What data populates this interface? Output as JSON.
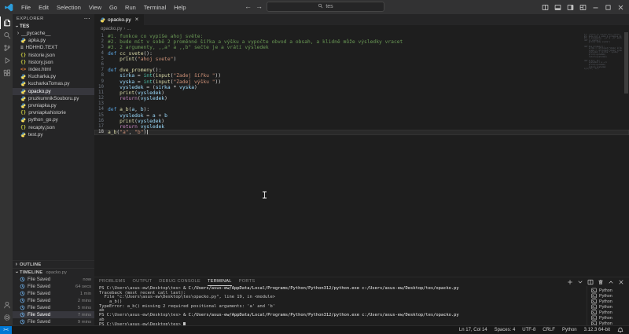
{
  "titlebar": {
    "menu": [
      "File",
      "Edit",
      "Selection",
      "View",
      "Go",
      "Run",
      "Terminal",
      "Help"
    ],
    "search_value": "tes",
    "window_icons": [
      "split-editor",
      "toggle-panel",
      "toggle-secondary-sidebar",
      "customize-layout",
      "minimize",
      "maximize",
      "close"
    ]
  },
  "activity_bar": {
    "top": [
      {
        "id": "explorer",
        "label": "Explorer",
        "active": true
      },
      {
        "id": "search",
        "label": "Search"
      },
      {
        "id": "source-control",
        "label": "Source Control"
      },
      {
        "id": "run-debug",
        "label": "Run and Debug"
      },
      {
        "id": "extensions",
        "label": "Extensions"
      }
    ],
    "bottom": [
      {
        "id": "accounts",
        "label": "Accounts"
      },
      {
        "id": "settings",
        "label": "Settings"
      }
    ]
  },
  "sidebar": {
    "explorer_title": "EXPLORER",
    "root": "TES",
    "files": [
      {
        "name": "__pycache__",
        "type": "folder"
      },
      {
        "name": "apka.py",
        "type": "python"
      },
      {
        "name": "HDHHD.TEXT",
        "type": "text"
      },
      {
        "name": "historie.json",
        "type": "json"
      },
      {
        "name": "history.json",
        "type": "json"
      },
      {
        "name": "index.html",
        "type": "html"
      },
      {
        "name": "Kucharka.py",
        "type": "python"
      },
      {
        "name": "kucharkaTomas.py",
        "type": "python"
      },
      {
        "name": "opacko.py",
        "type": "python",
        "selected": true
      },
      {
        "name": "pruzkumnikSouboru.py",
        "type": "python"
      },
      {
        "name": "prvniapka.py",
        "type": "python"
      },
      {
        "name": "prvniapkahistorie",
        "type": "json"
      },
      {
        "name": "python_go.py",
        "type": "python"
      },
      {
        "name": "recapty.json",
        "type": "json"
      },
      {
        "name": "test.py",
        "type": "python"
      }
    ],
    "outline_title": "OUTLINE",
    "timeline": {
      "title": "TIMELINE",
      "context": "opacko.py",
      "items": [
        {
          "label": "File Saved",
          "time": "now"
        },
        {
          "label": "File Saved",
          "time": "64 secs"
        },
        {
          "label": "File Saved",
          "time": "1 min"
        },
        {
          "label": "File Saved",
          "time": "2 mins"
        },
        {
          "label": "File Saved",
          "time": "5 mins"
        },
        {
          "label": "File Saved",
          "time": "7 mins",
          "selected": true
        },
        {
          "label": "File Saved",
          "time": "9 mins"
        }
      ]
    }
  },
  "editor": {
    "tab": {
      "name": "opacko.py"
    },
    "breadcrumb": [
      "opacko.py",
      "..."
    ],
    "cursor": {
      "line": 17,
      "col": 14
    },
    "lines": [
      {
        "segments": [
          {
            "t": "#1. funkce co vypíše ahoj světe:",
            "c": "cm"
          }
        ]
      },
      {
        "segments": [
          {
            "t": "#2. bude mít v sobě 2 proměnné šířka a výšku a vypočte obvod a obsah, a klidně může výsledky vracet",
            "c": "cm"
          }
        ]
      },
      {
        "segments": [
          {
            "t": "#3. 2 argumenty, ,,a\" a ,,b\" sečte je a vrátí výsledek",
            "c": "cm"
          }
        ]
      },
      {
        "segments": [
          {
            "t": "def ",
            "c": "kw"
          },
          {
            "t": "cc_svete",
            "c": "fn"
          },
          {
            "t": "():",
            "c": "pl"
          }
        ]
      },
      {
        "segments": [
          {
            "t": "    ",
            "c": "pl"
          },
          {
            "t": "print",
            "c": "fn"
          },
          {
            "t": "(",
            "c": "pl"
          },
          {
            "t": "\"ahoj svete\"",
            "c": "str"
          },
          {
            "t": ")",
            "c": "pl"
          }
        ]
      },
      {
        "segments": []
      },
      {
        "segments": [
          {
            "t": "def ",
            "c": "kw"
          },
          {
            "t": "dve_promeny",
            "c": "fn"
          },
          {
            "t": "():",
            "c": "pl"
          }
        ]
      },
      {
        "segments": [
          {
            "t": "    ",
            "c": "pl"
          },
          {
            "t": "sirka",
            "c": "var"
          },
          {
            "t": " = ",
            "c": "pl"
          },
          {
            "t": "int",
            "c": "bi"
          },
          {
            "t": "(",
            "c": "pl"
          },
          {
            "t": "input",
            "c": "fn"
          },
          {
            "t": "(",
            "c": "pl"
          },
          {
            "t": "\"Zadej šířku \"",
            "c": "str"
          },
          {
            "t": "))",
            "c": "pl"
          }
        ]
      },
      {
        "segments": [
          {
            "t": "    ",
            "c": "pl"
          },
          {
            "t": "vyska",
            "c": "var"
          },
          {
            "t": " = ",
            "c": "pl"
          },
          {
            "t": "int",
            "c": "bi"
          },
          {
            "t": "(",
            "c": "pl"
          },
          {
            "t": "input",
            "c": "fn"
          },
          {
            "t": "(",
            "c": "pl"
          },
          {
            "t": "\"Zadej výšku \"",
            "c": "str"
          },
          {
            "t": "))",
            "c": "pl"
          }
        ]
      },
      {
        "segments": [
          {
            "t": "    ",
            "c": "pl"
          },
          {
            "t": "vysledek",
            "c": "var"
          },
          {
            "t": " = (",
            "c": "pl"
          },
          {
            "t": "sirka",
            "c": "var"
          },
          {
            "t": " * ",
            "c": "pl"
          },
          {
            "t": "vyska",
            "c": "var"
          },
          {
            "t": ")",
            "c": "pl"
          }
        ]
      },
      {
        "segments": [
          {
            "t": "    ",
            "c": "pl"
          },
          {
            "t": "print",
            "c": "fn"
          },
          {
            "t": "(",
            "c": "pl"
          },
          {
            "t": "vysledek",
            "c": "var"
          },
          {
            "t": ")",
            "c": "pl"
          }
        ]
      },
      {
        "segments": [
          {
            "t": "    ",
            "c": "pl"
          },
          {
            "t": "return",
            "c": "ctl"
          },
          {
            "t": "(",
            "c": "pl"
          },
          {
            "t": "vysledek",
            "c": "var"
          },
          {
            "t": ")",
            "c": "pl"
          }
        ]
      },
      {
        "segments": []
      },
      {
        "segments": [
          {
            "t": "def ",
            "c": "kw"
          },
          {
            "t": "a_b",
            "c": "fn"
          },
          {
            "t": "(",
            "c": "pl"
          },
          {
            "t": "a",
            "c": "var"
          },
          {
            "t": ", ",
            "c": "pl"
          },
          {
            "t": "b",
            "c": "var"
          },
          {
            "t": "):",
            "c": "pl"
          }
        ]
      },
      {
        "segments": [
          {
            "t": "    ",
            "c": "pl"
          },
          {
            "t": "vysledok",
            "c": "var"
          },
          {
            "t": " = ",
            "c": "pl"
          },
          {
            "t": "a",
            "c": "var"
          },
          {
            "t": " + ",
            "c": "pl"
          },
          {
            "t": "b",
            "c": "var"
          }
        ]
      },
      {
        "segments": [
          {
            "t": "    ",
            "c": "pl"
          },
          {
            "t": "print",
            "c": "fn"
          },
          {
            "t": "(",
            "c": "pl"
          },
          {
            "t": "vysledek",
            "c": "var"
          },
          {
            "t": ")",
            "c": "pl"
          }
        ]
      },
      {
        "segments": [
          {
            "t": "    ",
            "c": "pl"
          },
          {
            "t": "return ",
            "c": "ctl"
          },
          {
            "t": "vysledek",
            "c": "var"
          }
        ]
      },
      {
        "segments": [
          {
            "t": "a_b",
            "c": "fn"
          },
          {
            "t": "(",
            "c": "pl"
          },
          {
            "t": "\"a\"",
            "c": "str"
          },
          {
            "t": ", ",
            "c": "pl"
          },
          {
            "t": "\"b\"",
            "c": "str"
          },
          {
            "t": ")",
            "c": "pl"
          }
        ],
        "current": true
      }
    ]
  },
  "panel": {
    "tabs": [
      {
        "label": "PROBLEMS"
      },
      {
        "label": "OUTPUT"
      },
      {
        "label": "DEBUG CONSOLE"
      },
      {
        "label": "TERMINAL",
        "active": true
      },
      {
        "label": "PORTS"
      }
    ],
    "actions": [
      "new-terminal",
      "launch-profile",
      "split-terminal",
      "kill-terminal",
      "maximize-panel",
      "close-panel"
    ],
    "terminal": [
      {
        "parts": [
          {
            "t": "PS C:\\Users\\asus-ew\\Desktop\\tes> ",
            "c": "prompt"
          },
          {
            "t": "& C:/Users/asus-ew/AppData/Local/Programs/Python/Python312/python.exe c:/Users/asus-ew/Desktop/tes/opacko.py",
            "c": "cmd"
          }
        ]
      },
      {
        "parts": [
          {
            "t": "Traceback (most recent call last):",
            "c": "out"
          }
        ]
      },
      {
        "parts": [
          {
            "t": "  File \"c:\\Users\\asus-ew\\Desktop\\tes\\opacko.py\", line 19, in <module>",
            "c": "out"
          }
        ]
      },
      {
        "parts": [
          {
            "t": "    a_b()",
            "c": "out"
          }
        ]
      },
      {
        "parts": [
          {
            "t": "TypeError: a_b() missing 2 required positional arguments: 'a' and 'b'",
            "c": "out"
          }
        ]
      },
      {
        "parts": [
          {
            "t": "ab",
            "c": "out"
          }
        ]
      },
      {
        "parts": [
          {
            "t": "PS C:\\Users\\asus-ew\\Desktop\\tes> ",
            "c": "prompt"
          },
          {
            "t": "& C:/Users/asus-ew/AppData/Local/Programs/Python/Python312/python.exe c:/Users/asus-ew/Desktop/tes/opacko.py",
            "c": "cmd"
          }
        ]
      },
      {
        "parts": [
          {
            "t": "ab",
            "c": "out"
          }
        ]
      },
      {
        "parts": [
          {
            "t": "PS C:\\Users\\asus-ew\\Desktop\\tes> ",
            "c": "prompt"
          }
        ],
        "cursor": true
      }
    ],
    "shells": [
      {
        "name": "Python"
      },
      {
        "name": "Python"
      },
      {
        "name": "Python"
      },
      {
        "name": "Python"
      },
      {
        "name": "Python"
      },
      {
        "name": "Python"
      },
      {
        "name": "Python"
      }
    ]
  },
  "status_bar": {
    "remote": "><",
    "items": [
      "Ln 17, Col 14",
      "Spaces: 4",
      "UTF-8",
      "CRLF",
      "Python",
      "3.12.3 64-bit"
    ]
  },
  "colors": {
    "accent": "#007acc",
    "comment": "#6a9955",
    "keyword": "#569cd6",
    "control": "#c586c0",
    "function": "#dcdcaa",
    "variable": "#9cdcfe",
    "string": "#ce9178",
    "builtin": "#4ec9b0"
  }
}
